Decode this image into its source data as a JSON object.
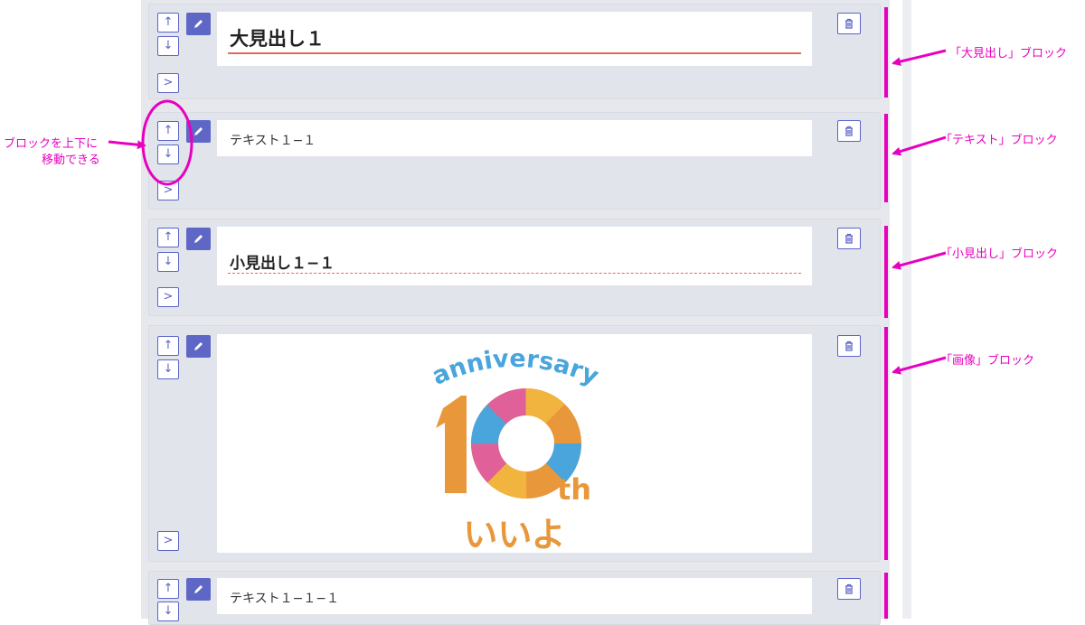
{
  "controls": {
    "up_label": "↑",
    "down_label": "↓",
    "expand_label": ">"
  },
  "blocks": [
    {
      "type": "大見出し",
      "text": "大見出し１"
    },
    {
      "type": "テキスト",
      "text": "テキスト１−１"
    },
    {
      "type": "小見出し",
      "text": "小見出し１−１"
    },
    {
      "type": "画像",
      "image": {
        "top_text": "anniversary",
        "number": "10",
        "suffix": "th",
        "bottom_text": "いいよ"
      }
    },
    {
      "type": "テキスト",
      "text": "テキスト１−１−１"
    }
  ],
  "annotations": {
    "heading_block": "「大見出し」ブロック",
    "text_block": "「テキスト」ブロック",
    "subheading_block": "「小見出し」ブロック",
    "image_block": "「画像」ブロック",
    "move_note_line1": "ブロックを上下に",
    "move_note_line2": "移動できる"
  },
  "colors": {
    "accent": "#5b64c7",
    "annotation": "#e800bf",
    "heading_rule": "#e06a5c",
    "logo_orange": "#e8973a",
    "logo_blue": "#4aa5dc",
    "logo_pink": "#e0609a",
    "logo_yellow": "#f0b43f"
  }
}
